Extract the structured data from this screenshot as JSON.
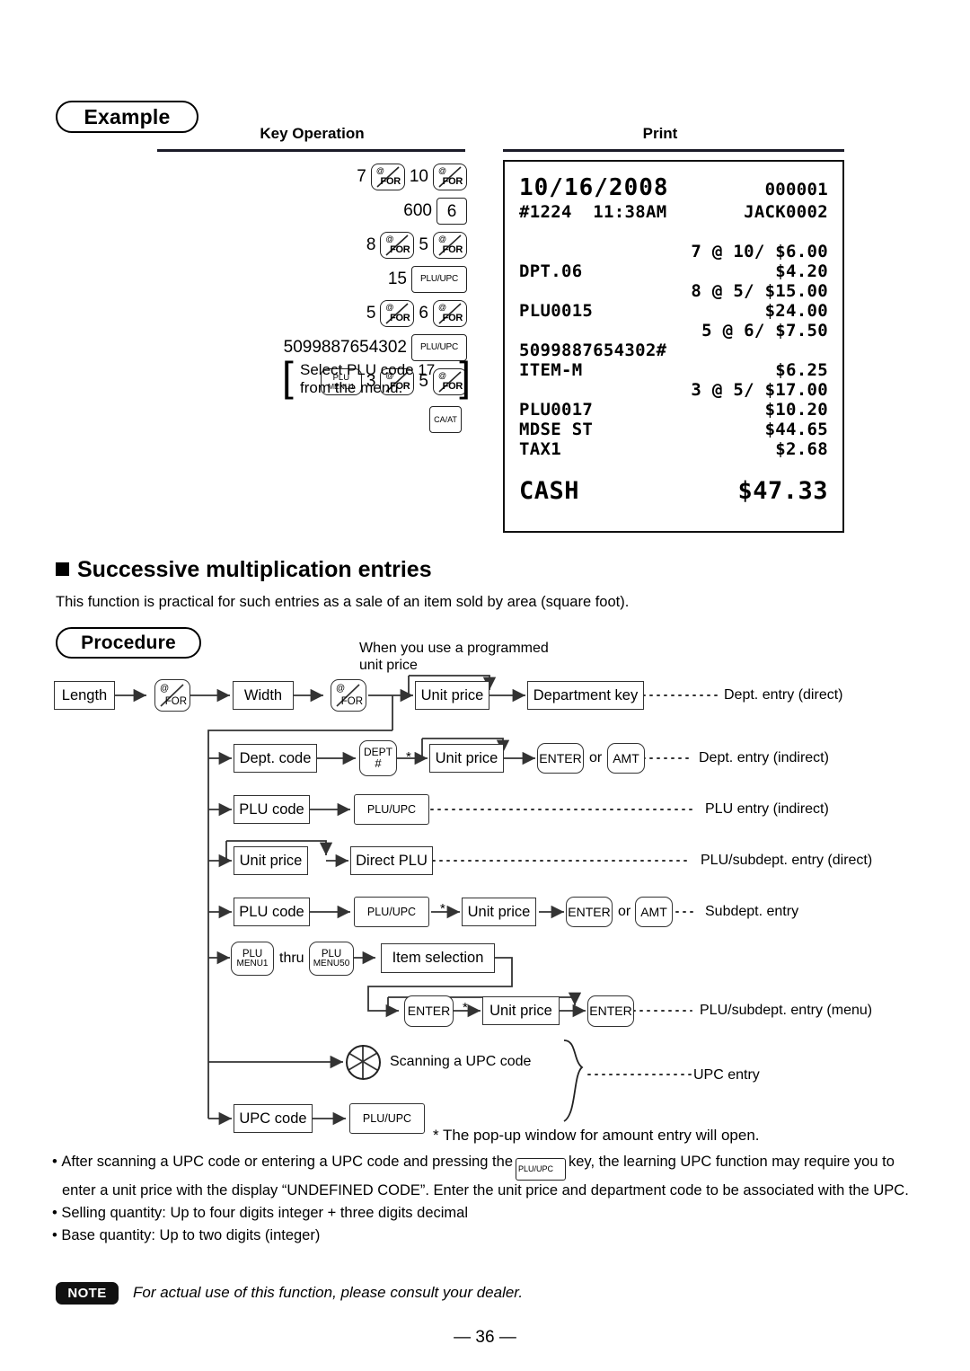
{
  "example": {
    "label": "Example",
    "col_key_operation": "Key Operation",
    "col_print": "Print",
    "key_rows": [
      {
        "id": "row1",
        "items": [
          {
            "t": "num",
            "v": "7"
          },
          {
            "t": "forkey",
            "v": "@/FOR"
          },
          {
            "t": "num",
            "v": "10"
          },
          {
            "t": "forkey",
            "v": "@/FOR"
          }
        ]
      },
      {
        "id": "row2",
        "items": [
          {
            "t": "num",
            "v": "600"
          },
          {
            "t": "numkey",
            "v": "6"
          }
        ]
      },
      {
        "id": "row3",
        "items": [
          {
            "t": "num",
            "v": "8"
          },
          {
            "t": "forkey",
            "v": "@/FOR"
          },
          {
            "t": "num",
            "v": "5"
          },
          {
            "t": "forkey",
            "v": "@/FOR"
          }
        ]
      },
      {
        "id": "row4",
        "items": [
          {
            "t": "num",
            "v": "15"
          },
          {
            "t": "pluupc",
            "v": "PLU/UPC"
          }
        ]
      },
      {
        "id": "row5",
        "items": [
          {
            "t": "num",
            "v": "5"
          },
          {
            "t": "forkey",
            "v": "@/FOR"
          },
          {
            "t": "num",
            "v": "6"
          },
          {
            "t": "forkey",
            "v": "@/FOR"
          }
        ]
      },
      {
        "id": "row6",
        "items": [
          {
            "t": "num",
            "v": "5099887654302"
          },
          {
            "t": "pluupc",
            "v": "PLU/UPC"
          }
        ]
      },
      {
        "id": "row7",
        "items": [
          {
            "t": "plumenu",
            "v1": "PLU",
            "v2": "MENU1"
          },
          {
            "t": "num",
            "v": "3"
          },
          {
            "t": "forkey",
            "v": "@/FOR"
          },
          {
            "t": "num",
            "v": "5"
          },
          {
            "t": "forkey",
            "v": "@/FOR"
          }
        ]
      }
    ],
    "bracket_note_line1": "Select PLU code 17",
    "bracket_note_line2": "from the menu.",
    "caat_key": "CA/AT",
    "receipt": {
      "date": "10/16/2008",
      "counter": "000001",
      "machine_no": "#1224",
      "time": "11:38AM",
      "clerk": "JACK0002",
      "lines": [
        {
          "left": "",
          "right": "7 @ 10/ $6.00",
          "style": "qty"
        },
        {
          "left": "DPT.06",
          "right": "$4.20",
          "style": "item"
        },
        {
          "left": "",
          "right": "8 @ 5/ $15.00",
          "style": "qty"
        },
        {
          "left": "PLU0015",
          "right": "$24.00",
          "style": "item"
        },
        {
          "left": "",
          "right": "5 @ 6/ $7.50",
          "style": "qty"
        },
        {
          "left": "5099887654302#",
          "right": "",
          "style": "item"
        },
        {
          "left": "ITEM-M",
          "right": "$6.25",
          "style": "item"
        },
        {
          "left": "",
          "right": "3 @ 5/ $17.00",
          "style": "qty"
        },
        {
          "left": "PLU0017",
          "right": "$10.20",
          "style": "item"
        },
        {
          "left": "MDSE ST",
          "right": "$44.65",
          "style": "item"
        },
        {
          "left": "TAX1",
          "right": "$2.68",
          "style": "item"
        }
      ],
      "total_label": "CASH",
      "total_amount": "$47.33"
    }
  },
  "section": {
    "heading": "Successive multiplication entries",
    "intro": "This function is practical for such entries as a sale of an item sold by area (square foot).",
    "procedure_label": "Procedure"
  },
  "flow": {
    "programmed_note_l1": "When you use a programmed",
    "programmed_note_l2": "unit price",
    "length": "Length",
    "width": "Width",
    "forkey": "@/FOR",
    "unit_price": "Unit price",
    "department_key": "Department key",
    "dept_code": "Dept. code",
    "dept_hash_l1": "DEPT",
    "dept_hash_l2": "#",
    "enter": "ENTER",
    "amt": "AMT",
    "or": "or",
    "plu_code": "PLU code",
    "pluupc": "PLU/UPC",
    "direct_plu": "Direct PLU",
    "plu_menu1_l1": "PLU",
    "plu_menu1_l2": "MENU1",
    "plu_menu50_l1": "PLU",
    "plu_menu50_l2": "MENU50",
    "thru": "thru",
    "item_selection": "Item selection",
    "scanning_upc": "Scanning a UPC code",
    "upc_code": "UPC code",
    "star": "*",
    "labels": {
      "dept_direct": "Dept. entry (direct)",
      "dept_indirect": "Dept. entry (indirect)",
      "plu_indirect": "PLU entry (indirect)",
      "plu_subdept_direct": "PLU/subdept. entry (direct)",
      "subdept": "Subdept. entry",
      "plu_subdept_menu": "PLU/subdept. entry (menu)",
      "upc_entry": "UPC entry"
    },
    "footnote": "*  The pop-up window for amount entry will open."
  },
  "bullets": {
    "b1_part1": "After scanning a UPC code or entering a UPC code and pressing the",
    "b1_key": "PLU/UPC",
    "b1_part2": "key, the learning UPC function may require you to enter a unit price with the display “UNDEFINED CODE”.  Enter the unit price and department code to be associated with the UPC.",
    "b2": "Selling quantity:  Up to four digits integer + three digits decimal",
    "b3": "Base quantity:    Up to two digits (integer)"
  },
  "note": {
    "badge": "NOTE",
    "text": "For actual use of this function, please consult your dealer."
  },
  "page_number": "— 36 —"
}
